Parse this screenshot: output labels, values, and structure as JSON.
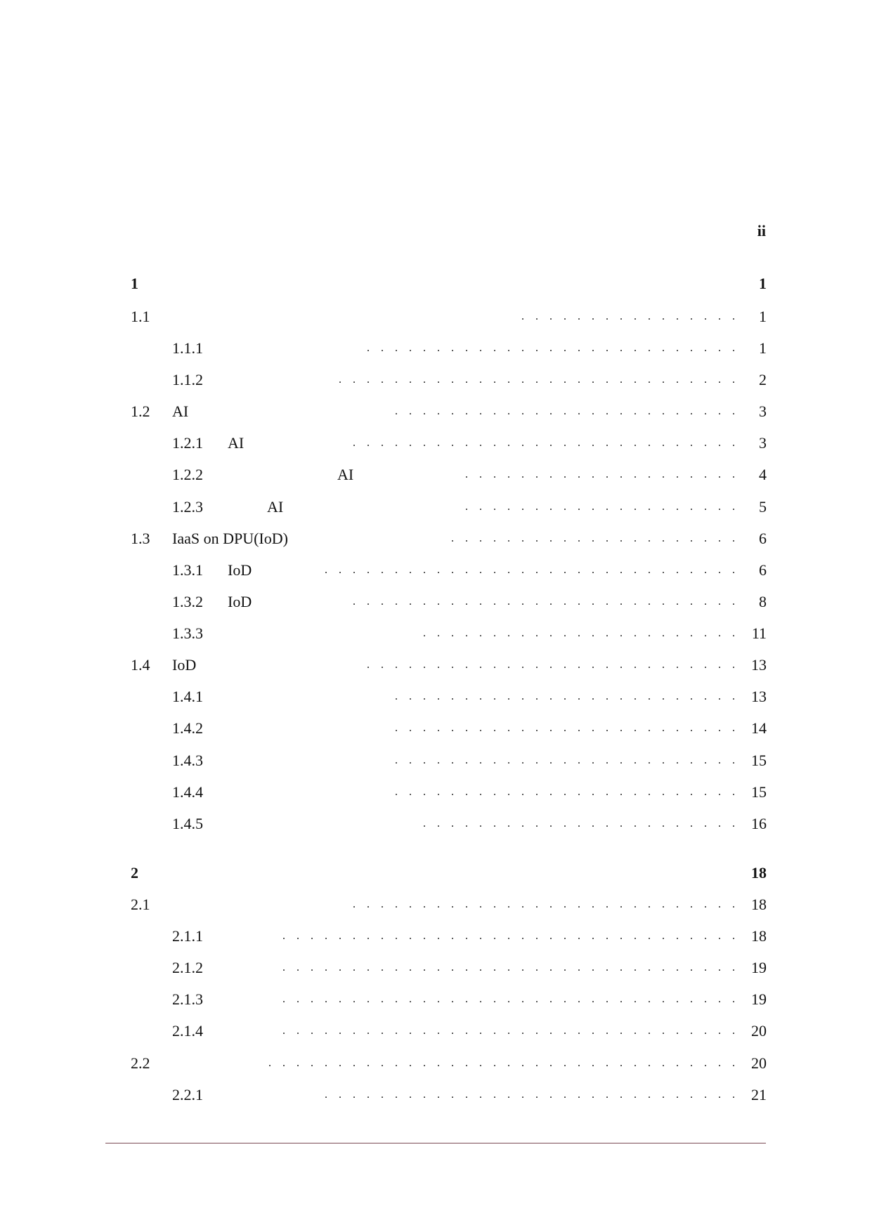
{
  "header": {
    "page_number": "ii"
  },
  "toc": [
    {
      "level": "chapter",
      "num": "1",
      "title": "",
      "page": "1"
    },
    {
      "level": "section",
      "num": "1.1",
      "title": "",
      "page": "1",
      "dots": 16
    },
    {
      "level": "subsection",
      "num": "1.1.1",
      "title": "",
      "page": "1",
      "dots": 27
    },
    {
      "level": "subsection",
      "num": "1.1.2",
      "title": "",
      "page": "2",
      "dots": 29
    },
    {
      "level": "section",
      "num": "1.2",
      "title": "AI",
      "page": "3",
      "dots": 25
    },
    {
      "level": "subsection",
      "num": "1.2.1",
      "title": "AI",
      "page": "3",
      "dots": 28
    },
    {
      "level": "subsection",
      "num": "1.2.2",
      "title": "AI",
      "page": "4",
      "dots": 20,
      "title_offset": "far"
    },
    {
      "level": "subsection",
      "num": "1.2.3",
      "title": "AI",
      "page": "5",
      "dots": 20,
      "title_offset": "mid"
    },
    {
      "level": "section",
      "num": "1.3",
      "title": "IaaS on DPU(IoD)",
      "page": "6",
      "dots": 21
    },
    {
      "level": "subsection",
      "num": "1.3.1",
      "title": "IoD",
      "page": "6",
      "dots": 30
    },
    {
      "level": "subsection",
      "num": "1.3.2",
      "title": "IoD",
      "page": "8",
      "dots": 28
    },
    {
      "level": "subsection",
      "num": "1.3.3",
      "title": "",
      "page": "11",
      "dots": 23
    },
    {
      "level": "section",
      "num": "1.4",
      "title": "IoD",
      "page": "13",
      "dots": 27
    },
    {
      "level": "subsection",
      "num": "1.4.1",
      "title": "",
      "page": "13",
      "dots": 25
    },
    {
      "level": "subsection",
      "num": "1.4.2",
      "title": "",
      "page": "14",
      "dots": 25
    },
    {
      "level": "subsection",
      "num": "1.4.3",
      "title": "",
      "page": "15",
      "dots": 25
    },
    {
      "level": "subsection",
      "num": "1.4.4",
      "title": "",
      "page": "15",
      "dots": 25
    },
    {
      "level": "subsection",
      "num": "1.4.5",
      "title": "",
      "page": "16",
      "dots": 23
    },
    {
      "level": "chapter",
      "num": "2",
      "title": "",
      "page": "18"
    },
    {
      "level": "section",
      "num": "2.1",
      "title": "",
      "page": "18",
      "dots": 28
    },
    {
      "level": "subsection",
      "num": "2.1.1",
      "title": "",
      "page": "18",
      "dots": 33
    },
    {
      "level": "subsection",
      "num": "2.1.2",
      "title": "",
      "page": "19",
      "dots": 33
    },
    {
      "level": "subsection",
      "num": "2.1.3",
      "title": "",
      "page": "19",
      "dots": 33
    },
    {
      "level": "subsection",
      "num": "2.1.4",
      "title": "",
      "page": "20",
      "dots": 33
    },
    {
      "level": "section",
      "num": "2.2",
      "title": "",
      "page": "20",
      "dots": 34
    },
    {
      "level": "subsection",
      "num": "2.2.1",
      "title": "",
      "page": "21",
      "dots": 30
    }
  ],
  "colors": {
    "footer_rule": "#7a4a55"
  }
}
